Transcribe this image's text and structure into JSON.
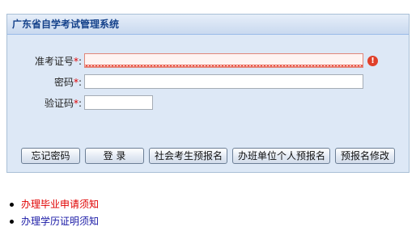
{
  "panel": {
    "title": "广东省自学考试管理系统"
  },
  "form": {
    "exam_id": {
      "label": "准考证号",
      "required_mark": "*",
      "colon": ":",
      "value": "",
      "placeholder": "",
      "error_icon": "error-icon"
    },
    "password": {
      "label": "密码",
      "required_mark": "*",
      "colon": ":",
      "value": ""
    },
    "captcha": {
      "label": "验证码",
      "required_mark": "*",
      "colon": ":",
      "value": ""
    }
  },
  "buttons": {
    "forgot": "忘记密码",
    "login": "登 录",
    "social_prereg": "社会考生预报名",
    "org_prereg": "办班单位个人预报名",
    "modify_prereg": "预报名修改"
  },
  "links": [
    {
      "text": "办理毕业申请须知",
      "color": "#e00000"
    },
    {
      "text": "办理学历证明须知",
      "color": "#1a1aa6"
    }
  ],
  "colors": {
    "panel_bg": "#dde8f6",
    "header_text": "#15428b",
    "required": "#e00000",
    "error": "#e0402a"
  }
}
